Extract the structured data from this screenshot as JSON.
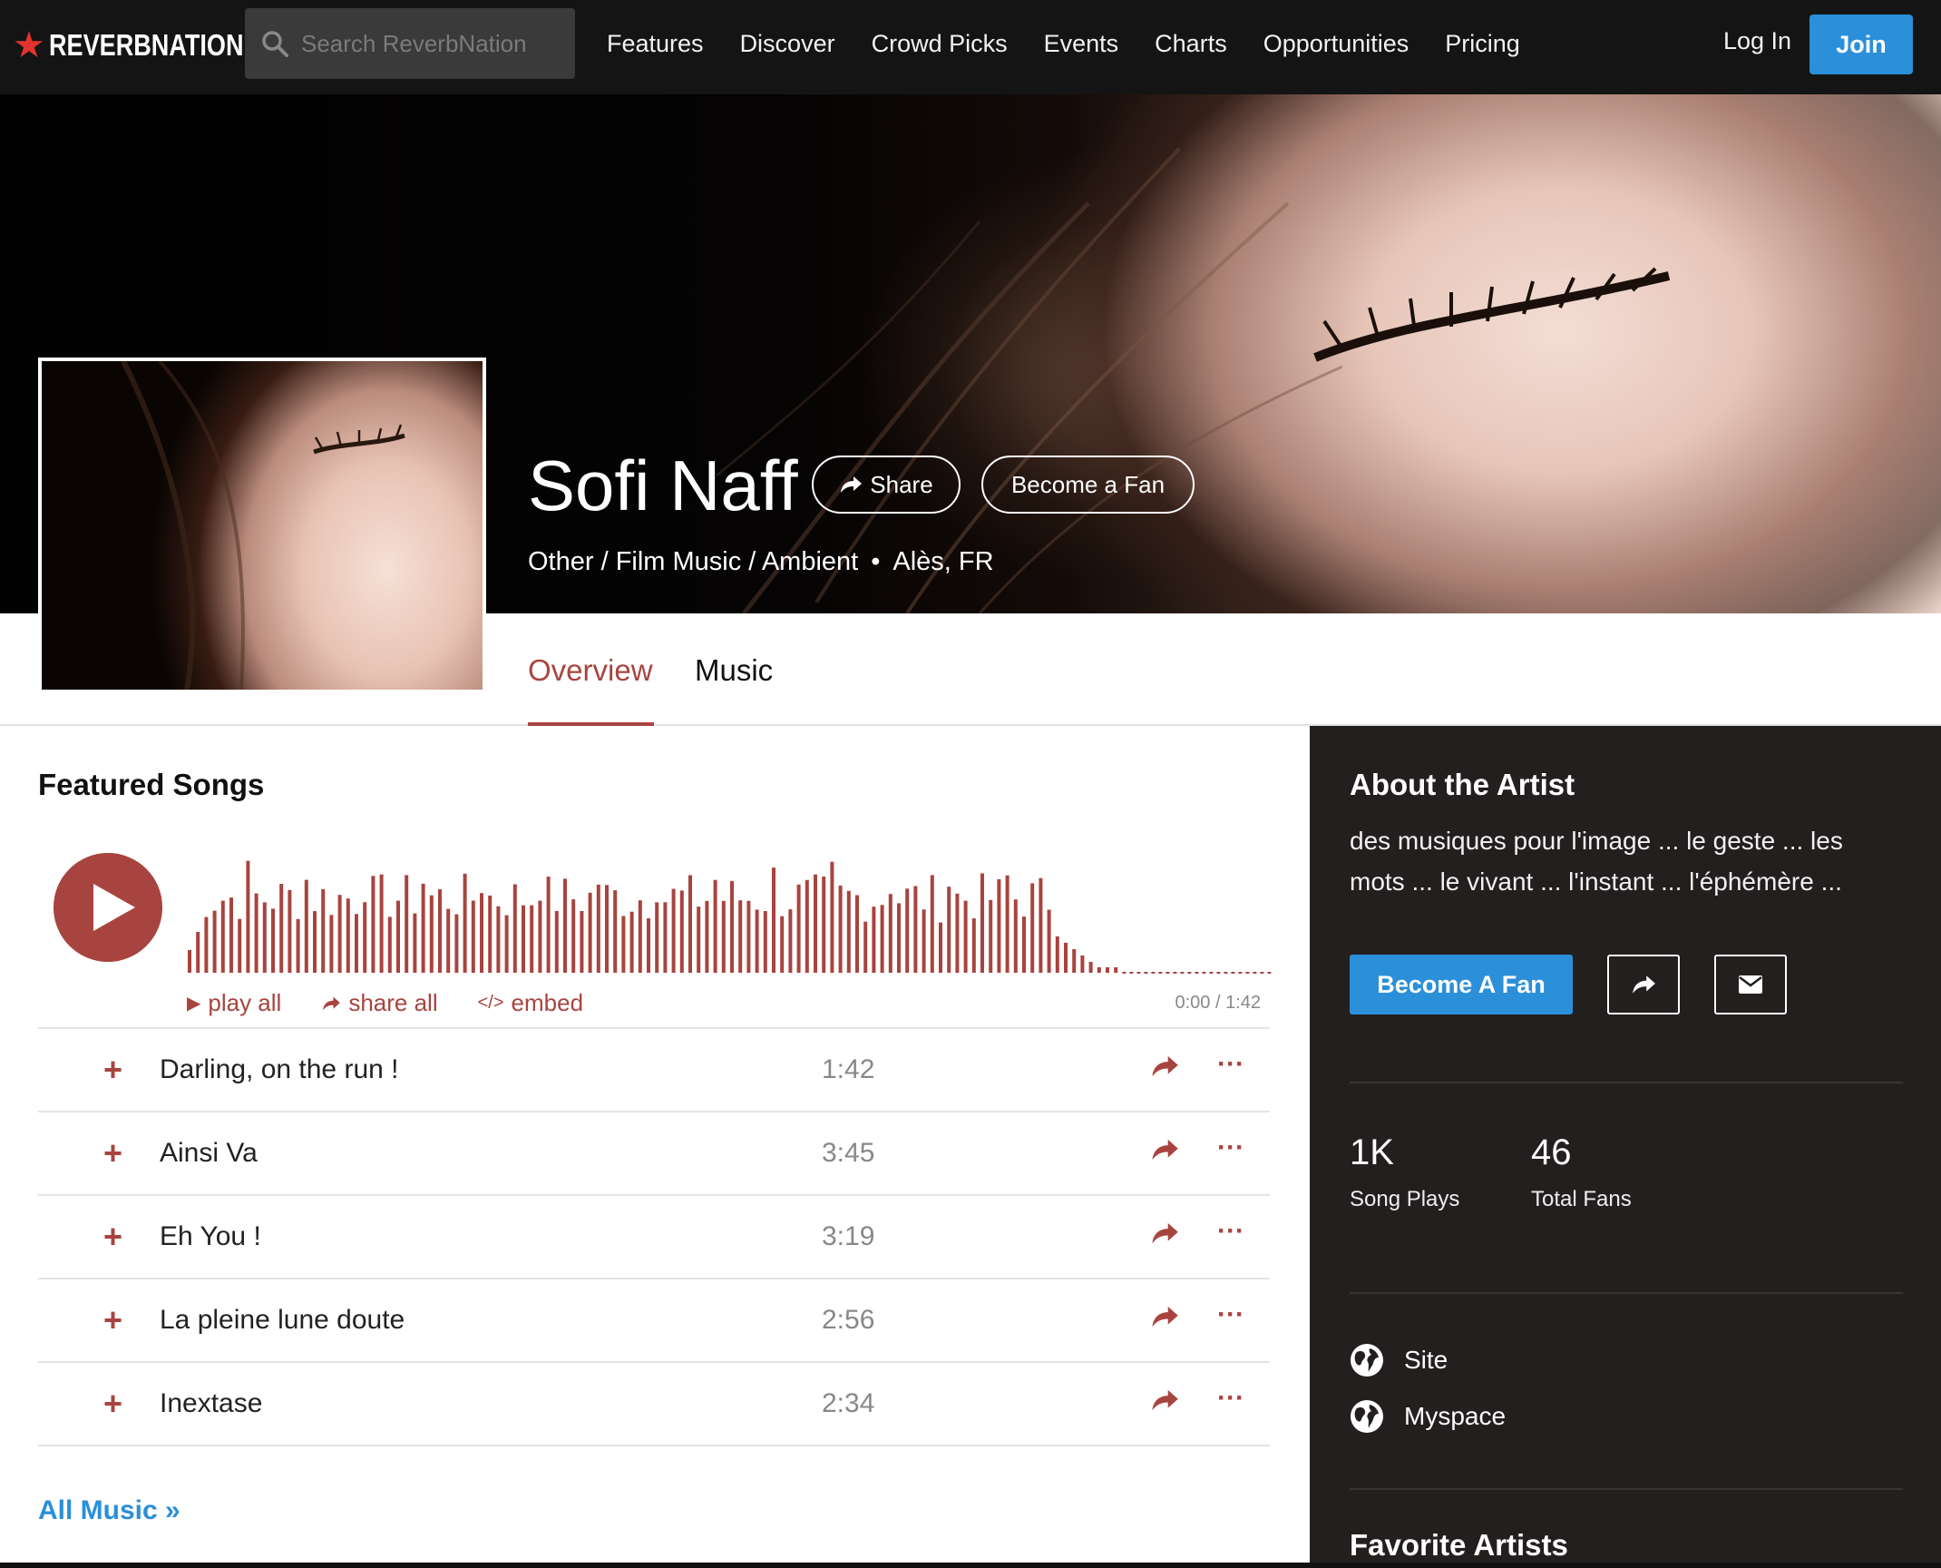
{
  "nav": {
    "logo_text": "REVERBNATION",
    "search_placeholder": "Search ReverbNation",
    "links": [
      "Features",
      "Discover",
      "Crowd Picks",
      "Events",
      "Charts",
      "Opportunities",
      "Pricing"
    ],
    "login": "Log In",
    "join": "Join"
  },
  "artist": {
    "name": "Sofi Naff",
    "share_label": "Share",
    "become_fan_label": "Become a Fan",
    "genres": "Other / Film Music / Ambient",
    "location": "Alès, FR"
  },
  "tabs": {
    "overview": "Overview",
    "music": "Music"
  },
  "featured": {
    "title": "Featured Songs",
    "play_all": "play all",
    "share_all": "share all",
    "embed": "embed",
    "time_current": "0:00",
    "time_total": "1:42",
    "songs": [
      {
        "title": "Darling, on the run !",
        "duration": "1:42"
      },
      {
        "title": "Ainsi Va",
        "duration": "3:45"
      },
      {
        "title": "Eh You !",
        "duration": "3:19"
      },
      {
        "title": "La pleine lune doute",
        "duration": "2:56"
      },
      {
        "title": "Inextase",
        "duration": "2:34"
      }
    ],
    "all_music": "All Music »"
  },
  "sidebar": {
    "about_title": "About the Artist",
    "about_text": "des musiques pour l'image ... le geste ... les mots ... le vivant ... l'instant ... l'éphémère ...",
    "become_fan": "Become A Fan",
    "stats": [
      {
        "value": "1K",
        "label": "Song Plays"
      },
      {
        "value": "46",
        "label": "Total Fans"
      }
    ],
    "links": [
      "Site",
      "Myspace"
    ],
    "favorite_title": "Favorite Artists"
  },
  "colors": {
    "accent": "#a8443f",
    "blue": "#2b8fd9",
    "nav_bg": "#141414",
    "sidebar_bg": "#241f1f"
  }
}
